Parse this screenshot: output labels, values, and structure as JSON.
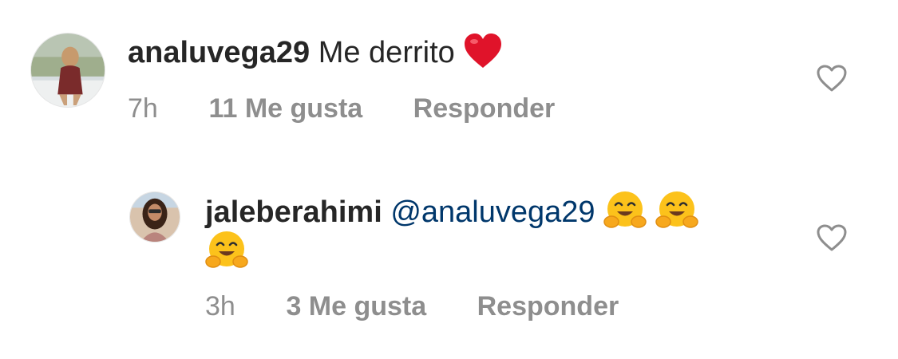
{
  "comments": [
    {
      "username": "analuvega29",
      "text": "Me derrito",
      "emoji": "red-heart",
      "time": "7h",
      "likes": "11 Me gusta",
      "reply": "Responder"
    },
    {
      "username": "jaleberahimi",
      "mention": "@analuvega29",
      "emojis": [
        "hugging-face",
        "hugging-face",
        "hugging-face"
      ],
      "time": "3h",
      "likes": "3 Me gusta",
      "reply": "Responder"
    }
  ],
  "icons": {
    "like": "heart-outline-icon"
  },
  "colors": {
    "username": "#262626",
    "mention": "#00376b",
    "meta": "#8e8e8e",
    "heart_emoji": "#e0132a",
    "hug_emoji": "#fcc21b"
  }
}
